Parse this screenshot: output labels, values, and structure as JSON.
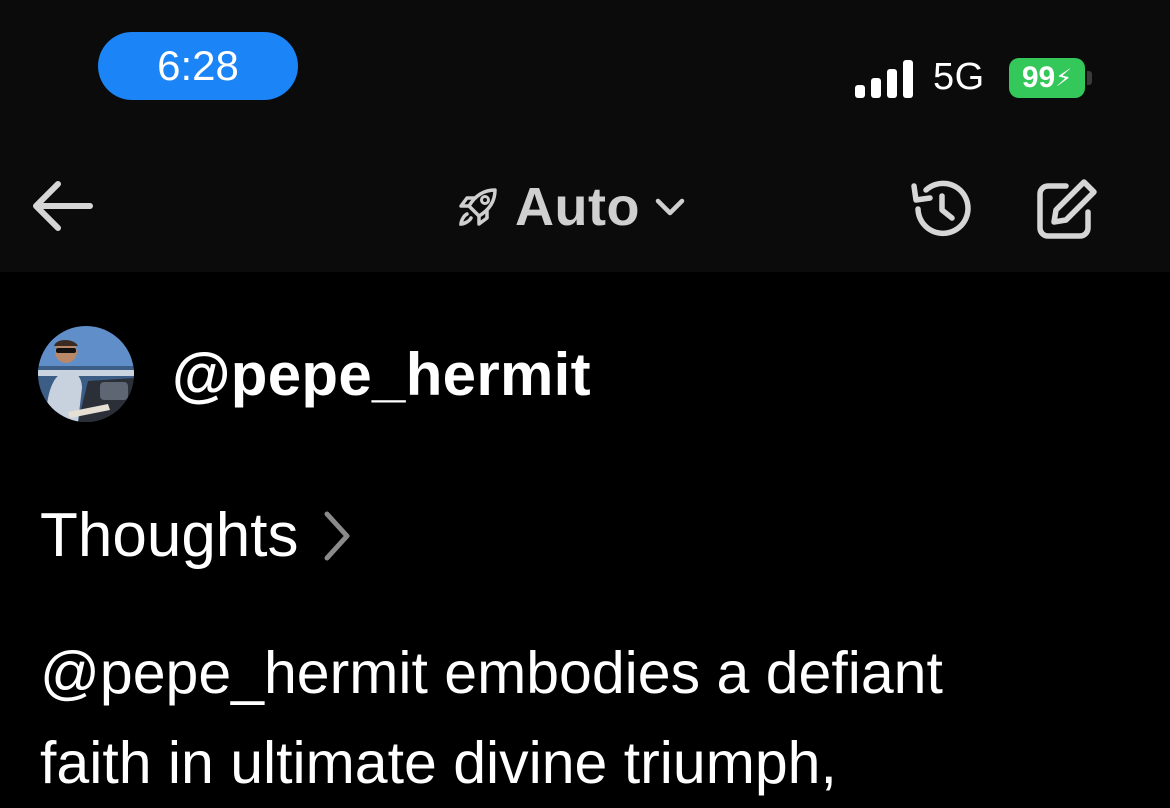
{
  "status_bar": {
    "time": "6:28",
    "network": "5G",
    "battery": "99",
    "battery_charging_symbol": "⚡",
    "colors": {
      "time_pill": "#1b84f7",
      "battery": "#34c759"
    }
  },
  "nav": {
    "back_icon": "back-arrow-icon",
    "mode_icon": "rocket-icon",
    "mode_label": "Auto",
    "mode_chevron_icon": "chevron-down-icon",
    "history_icon": "history-icon",
    "compose_icon": "compose-icon"
  },
  "post": {
    "username": "@pepe_hermit",
    "thoughts_label": "Thoughts",
    "thoughts_chevron_icon": "chevron-right-icon",
    "body_lines": [
      "@pepe_hermit embodies a defiant",
      "faith in ultimate divine triumph,"
    ]
  }
}
